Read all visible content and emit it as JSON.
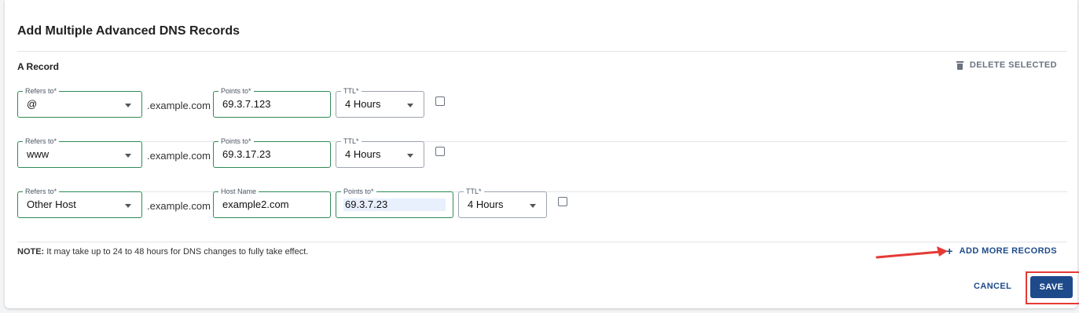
{
  "dialog": {
    "title": "Add Multiple Advanced DNS Records",
    "section_label": "A Record",
    "delete_selected_label": "DELETE SELECTED",
    "domain_suffix": ".example.com",
    "records": [
      {
        "refers_to": {
          "label": "Refers to*",
          "value": "@"
        },
        "points_to": {
          "label": "Points to*",
          "value": "69.3.7.123"
        },
        "ttl": {
          "label": "TTL*",
          "value": "4 Hours"
        },
        "selected": false
      },
      {
        "refers_to": {
          "label": "Refers to*",
          "value": "www"
        },
        "points_to": {
          "label": "Points to*",
          "value": "69.3.17.23"
        },
        "ttl": {
          "label": "TTL*",
          "value": "4 Hours"
        },
        "selected": false
      },
      {
        "refers_to": {
          "label": "Refers to*",
          "value": "Other Host"
        },
        "host_name": {
          "label": "Host Name",
          "value": "example2.com"
        },
        "points_to": {
          "label": "Points to*",
          "value": "69.3.7.23"
        },
        "ttl": {
          "label": "TTL*",
          "value": "4 Hours"
        },
        "selected": false
      }
    ],
    "note_prefix": "NOTE:",
    "note_text": " It may take up to 24 to 48 hours for DNS changes to fully take effect.",
    "add_more_label": "ADD MORE RECORDS",
    "cancel_label": "CANCEL",
    "save_label": "SAVE"
  },
  "colors": {
    "accent": "#1e4a8a",
    "field_border_active": "#2e8b57",
    "annotation_red": "#e53935"
  }
}
